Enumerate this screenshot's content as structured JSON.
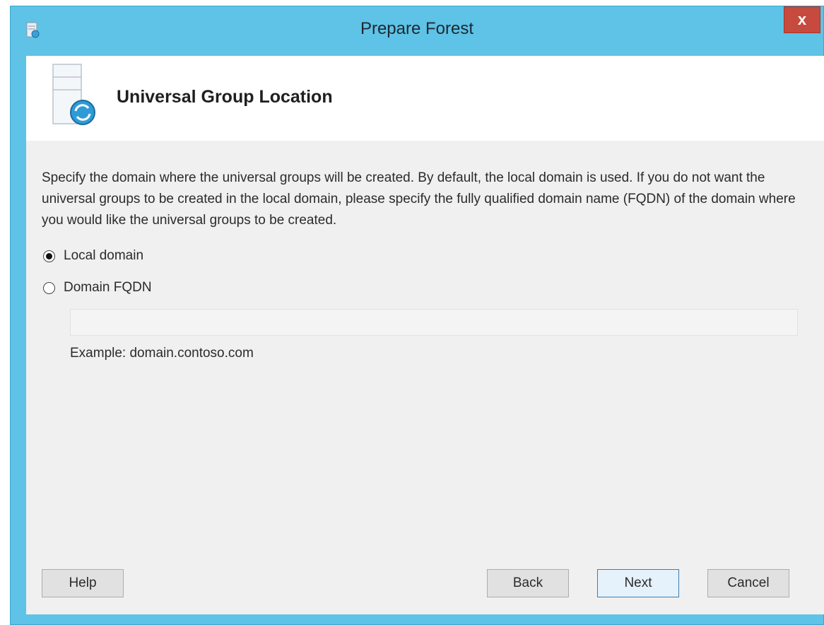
{
  "window": {
    "title": "Prepare Forest",
    "close_label": "x"
  },
  "header": {
    "title": "Universal Group Location"
  },
  "content": {
    "description": "Specify the domain where the universal groups will be created. By default, the local domain is used. If you do not want the universal groups to be created in the local domain, please specify the fully qualified domain name (FQDN) of the domain where you would like the universal groups to be created.",
    "options": [
      {
        "label": "Local domain",
        "selected": true
      },
      {
        "label": "Domain FQDN",
        "selected": false
      }
    ],
    "fqdn_value": "",
    "example": "Example: domain.contoso.com"
  },
  "buttons": {
    "help": "Help",
    "back": "Back",
    "next": "Next",
    "cancel": "Cancel"
  },
  "colors": {
    "titlebar": "#5ec3e6",
    "close": "#c74a3e",
    "content_bg": "#f0f0f0"
  }
}
